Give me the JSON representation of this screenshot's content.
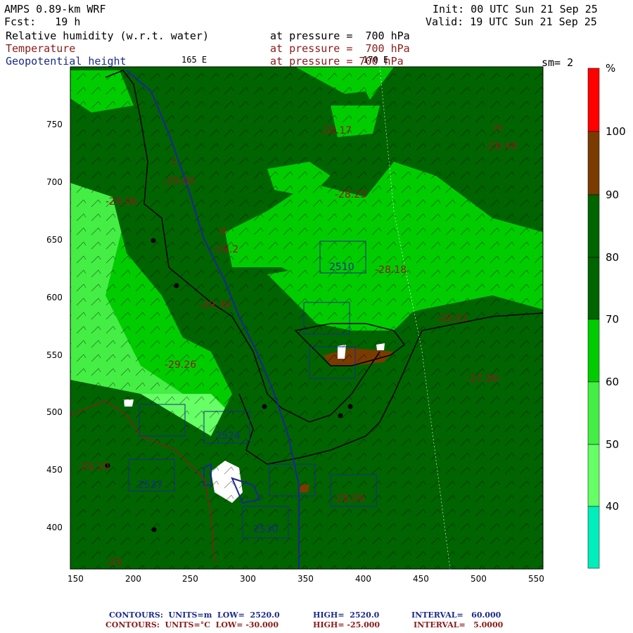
{
  "header": {
    "model": "AMPS 0.89-km WRF",
    "fcst": "Fcst:   19 h",
    "init": "Init: 00 UTC Sun 21 Sep 25",
    "valid": "Valid: 19 UTC Sun 21 Sep 25",
    "field1": "Relative humidity (w.r.t. water)",
    "field1_lev": "at pressure =  700 hPa",
    "field2": "Temperature",
    "field2_lev": "at pressure =  700 hPa",
    "field3": "Geopotential height",
    "field3_lev": "at pressure = 700 hPa",
    "lon_label_left": "165 E",
    "lon_label_right": "170 E",
    "smoothing": "sm= 2"
  },
  "axes": {
    "x_ticks": [
      "150",
      "200",
      "250",
      "300",
      "350",
      "400",
      "450",
      "500",
      "550"
    ],
    "y_ticks": [
      "750",
      "700",
      "650",
      "600",
      "550",
      "500",
      "450",
      "400"
    ]
  },
  "colorbar": {
    "unit": "%",
    "labels": [
      "100",
      "90",
      "80",
      "70",
      "60",
      "50",
      "40"
    ],
    "colors": [
      "#ff0000",
      "#7a3b00",
      "#006400",
      "#006400",
      "#00cc00",
      "#44ee44",
      "#66ff66",
      "#00eebb"
    ]
  },
  "contour_labels": [
    {
      "text": "H",
      "c": "red"
    },
    {
      "text": "-26.44",
      "c": "red"
    },
    {
      "text": "L",
      "c": "red"
    },
    {
      "text": "-29.00",
      "c": "red"
    },
    {
      "text": "-29.06",
      "c": "red"
    },
    {
      "text": "H",
      "c": "red"
    },
    {
      "text": "-28.2",
      "c": "red"
    },
    {
      "text": "-28.17",
      "c": "red"
    },
    {
      "text": "-28.23",
      "c": "red"
    },
    {
      "text": "2510",
      "c": "blue"
    },
    {
      "text": "-28.18",
      "c": "red"
    },
    {
      "text": "-29.36",
      "c": "red"
    },
    {
      "text": "-28.01",
      "c": "red"
    },
    {
      "text": "-29.26",
      "c": "red"
    },
    {
      "text": "-27.99",
      "c": "red"
    },
    {
      "text": "2524",
      "c": "blue"
    },
    {
      "text": "2537",
      "c": "blue"
    },
    {
      "text": "2530",
      "c": "blue"
    },
    {
      "text": "-29.10",
      "c": "red"
    },
    {
      "text": "-28.06",
      "c": "red"
    },
    {
      "text": "-29",
      "c": "red"
    }
  ],
  "footer": {
    "line1_a": "CONTOURS:  UNITS=m  LOW=  2520.0",
    "line1_b": "HIGH=  2520.0",
    "line1_c": "INTERVAL=   60.000",
    "line2_a": "CONTOURS:  UNITS=°C  LOW= -30.000",
    "line2_b": "HIGH= -25.000",
    "line2_c": "INTERVAL=   5.0000"
  }
}
